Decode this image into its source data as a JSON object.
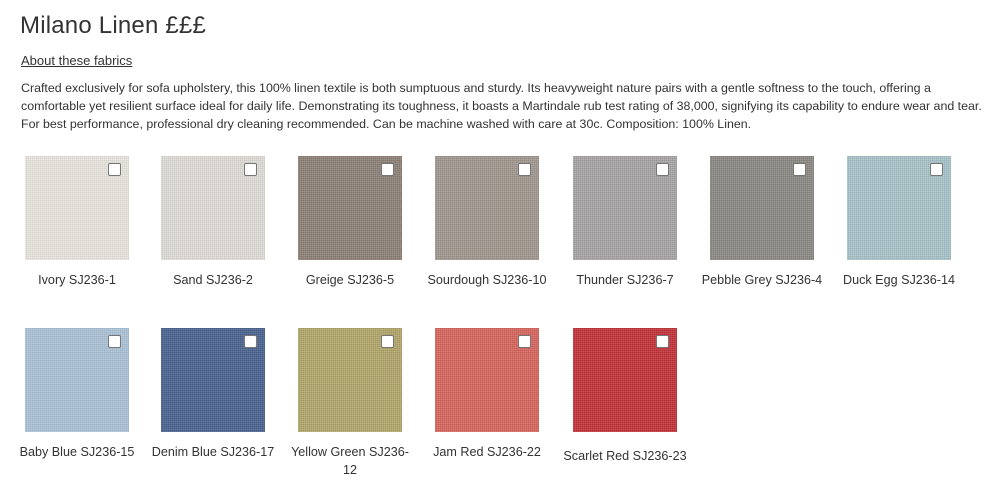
{
  "title": "Milano Linen £££",
  "about_link": "About these fabrics",
  "description": "Crafted exclusively for sofa upholstery, this 100% linen textile is both sumptuous and sturdy. Its heavyweight nature pairs with a gentle softness to the touch, offering a comfortable yet resilient surface ideal for daily life. Demonstrating its toughness, it boasts a Martindale rub test rating of 38,000, signifying its capability to endure wear and tear. For best performance, professional dry cleaning recommended. Can be machine washed with care at 30c. Composition: 100% Linen.",
  "swatches": [
    {
      "label": "Ivory SJ236-1",
      "color": "#ece8e1"
    },
    {
      "label": "Sand SJ236-2",
      "color": "#e2dfd9"
    },
    {
      "label": "Greige SJ236-5",
      "color": "#8e8378"
    },
    {
      "label": "Sourdough SJ236-10",
      "color": "#a39a91"
    },
    {
      "label": "Thunder SJ236-7",
      "color": "#a9a7a8"
    },
    {
      "label": "Pebble Grey SJ236-4",
      "color": "#8e8b86"
    },
    {
      "label": "Duck Egg SJ236-14",
      "color": "#a9c6cb"
    },
    {
      "label": "Baby Blue SJ236-15",
      "color": "#aec5da"
    },
    {
      "label": "Denim Blue SJ236-17",
      "color": "#4b6592"
    },
    {
      "label": "Yellow Green SJ236-12",
      "color": "#b4a86c"
    },
    {
      "label": "Jam Red SJ236-22",
      "color": "#d9675f"
    },
    {
      "label": "Scarlet Red SJ236-23",
      "color": "#c6333b"
    }
  ]
}
